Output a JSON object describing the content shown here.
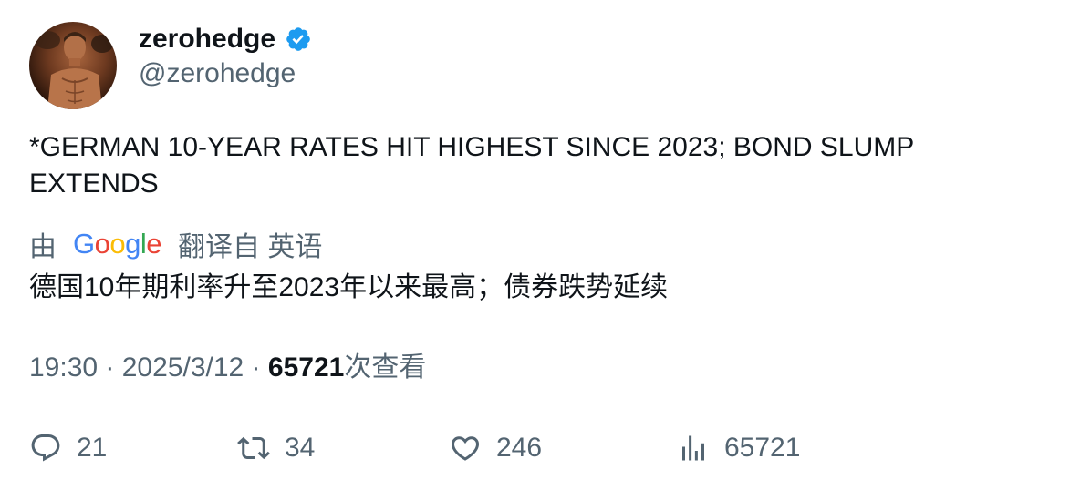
{
  "author": {
    "display_name": "zerohedge",
    "handle": "@zerohedge",
    "verified": true,
    "verified_color": "#1d9bf0"
  },
  "tweet": {
    "text": "*GERMAN 10-YEAR RATES HIT HIGHEST SINCE 2023; BOND SLUMP EXTENDS"
  },
  "translation": {
    "prefix": "由",
    "provider": "Google",
    "suffix": "翻译自 英语",
    "text": "德国10年期利率升至2023年以来最高；债券跌势延续"
  },
  "meta": {
    "time": "19:30",
    "separator": " · ",
    "date": "2025/3/12",
    "views_count": "65721",
    "views_label": "次查看"
  },
  "actions": {
    "replies": "21",
    "retweets": "34",
    "likes": "246",
    "views": "65721"
  },
  "colors": {
    "text_primary": "#0f1419",
    "text_secondary": "#536471",
    "accent": "#1d9bf0"
  }
}
